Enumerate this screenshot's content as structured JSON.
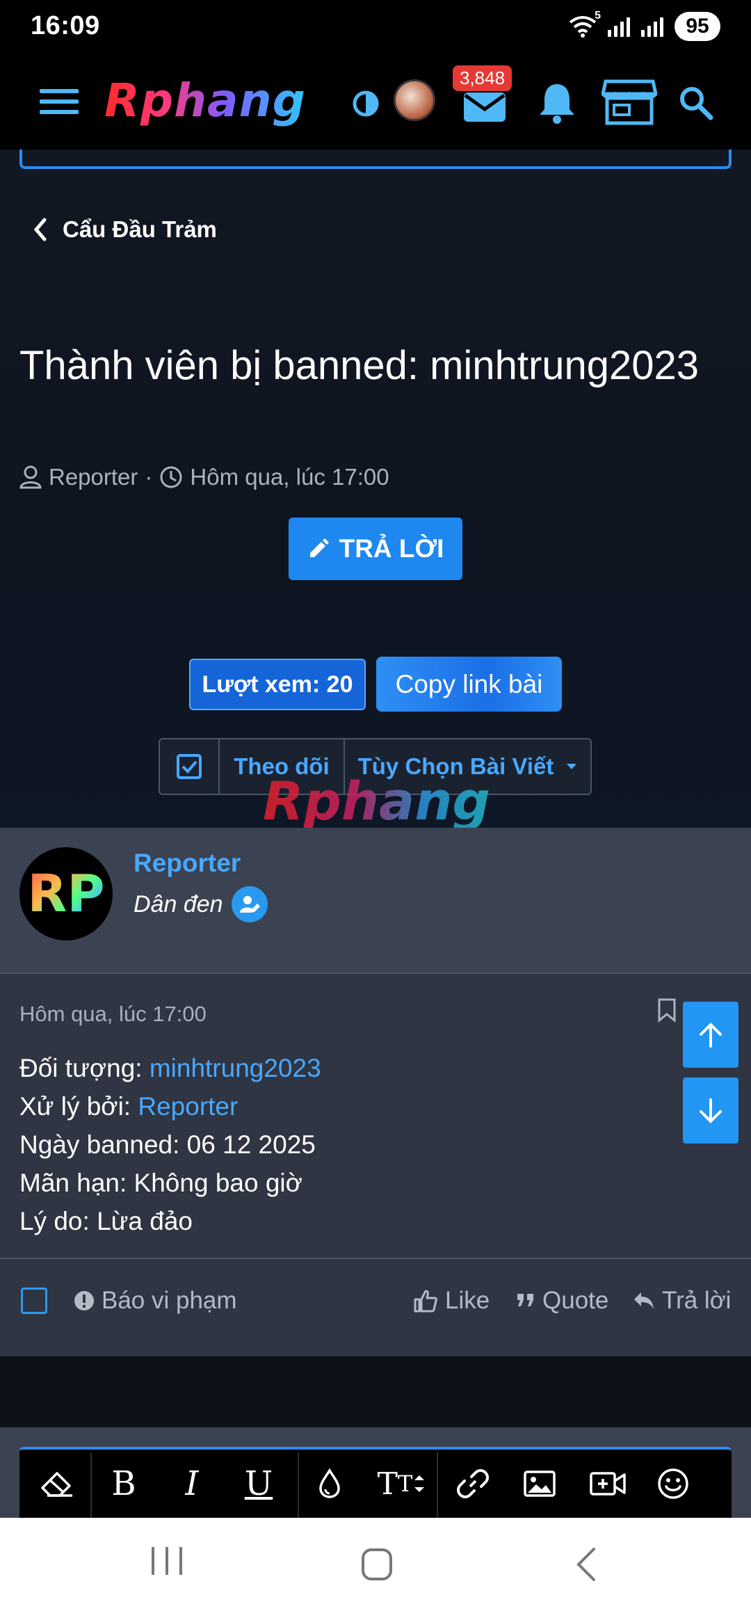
{
  "status_bar": {
    "time": "16:09",
    "wifi_label": "5",
    "battery": "95"
  },
  "nav": {
    "logo": "Rphang",
    "badge": "3,848"
  },
  "breadcrumb": "Cẩu Đầu Trảm",
  "thread": {
    "title": "Thành viên bị banned: minhtrung2023",
    "author": "Reporter",
    "separator": "·",
    "time": "Hôm qua, lúc 17:00",
    "reply_button": "TRẢ LỜI",
    "views": "Lượt xem: 20",
    "copy_link": "Copy link bài",
    "follow": "Theo dõi",
    "options": "Tùy Chọn Bài Viết"
  },
  "watermark": "Rphang",
  "post": {
    "avatar_text": "RP",
    "username": "Reporter",
    "role": "Dân đen",
    "date": "Hôm qua, lúc 17:00",
    "lines": [
      {
        "label": "Đối tượng: ",
        "value": "minhtrung2023"
      },
      {
        "label": "Xử lý bởi: ",
        "value": "Reporter"
      },
      {
        "label": "Ngày banned: 06 12 2025"
      },
      {
        "label": "Mãn hạn: Không bao giờ"
      },
      {
        "label": "Lý do: Lừa đảo"
      }
    ],
    "report": "Báo vi phạm",
    "like": "Like",
    "quote": "Quote",
    "reply": "Trả lời"
  },
  "colors": {
    "accent": "#2196f3",
    "link": "#4aa8ff",
    "badge": "#e53935"
  }
}
